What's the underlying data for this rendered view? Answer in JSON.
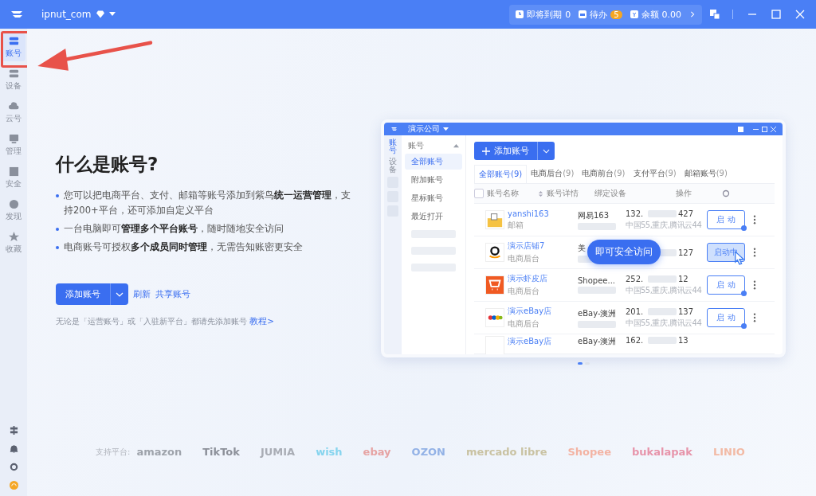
{
  "titlebar": {
    "account": "ipnut_com",
    "stats": [
      {
        "kind": "clock",
        "label": "即将到期",
        "value": "0"
      },
      {
        "kind": "todo",
        "label": "待办",
        "value": "5"
      },
      {
        "kind": "wallet",
        "label": "余额",
        "value": "0.00"
      }
    ]
  },
  "sidebar": {
    "items": [
      {
        "kind": "account",
        "label": "账号",
        "selected": true
      },
      {
        "kind": "device",
        "label": "设备",
        "selected": false
      },
      {
        "kind": "cloud",
        "label": "云号",
        "selected": false
      },
      {
        "kind": "monitor",
        "label": "管理",
        "selected": false
      },
      {
        "kind": "shield",
        "label": "安全",
        "selected": false
      },
      {
        "kind": "compass",
        "label": "发现",
        "selected": false
      },
      {
        "kind": "star",
        "label": "收藏",
        "selected": false
      }
    ]
  },
  "intro": {
    "title": "什么是账号?",
    "bullets": [
      "您可以把电商平台、支付、邮箱等账号添加到紫鸟**统一运营管理**，支持200+平台，还可添加自定义平台",
      "一台电脑即可**管理多个平台账号**，随时随地安全访问",
      "电商账号可授权**多个成员同时管理**，无需告知账密更安全"
    ],
    "add_button": "添加账号",
    "links": [
      "刷新",
      "共享账号"
    ],
    "note": "无论是「运营账号」或「入驻新平台」都请先添加账号",
    "note_link": "教程>"
  },
  "preview": {
    "company": "演示公司",
    "side_items": [
      {
        "label": "账号",
        "selected": true
      },
      {
        "label": "设备",
        "selected": false
      }
    ],
    "nav_group": "账号",
    "nav_items": [
      {
        "label": "全部账号",
        "selected": true
      },
      {
        "label": "附加账号",
        "selected": false
      },
      {
        "label": "星标账号",
        "selected": false
      },
      {
        "label": "最近打开",
        "selected": false
      }
    ],
    "add_button": "添加账号",
    "tabs": [
      {
        "label": "全部账号",
        "count": "(9)",
        "selected": true
      },
      {
        "label": "电商后台",
        "count": "(9)",
        "selected": false
      },
      {
        "label": "电商前台",
        "count": "(9)",
        "selected": false
      },
      {
        "label": "支付平台",
        "count": "(9)",
        "selected": false
      },
      {
        "label": "邮箱账号",
        "count": "(9)",
        "selected": false
      }
    ],
    "columns": [
      "账号名称",
      "账号详情",
      "绑定设备",
      "操作"
    ],
    "rows": [
      {
        "kind": "mail",
        "name": "yanshi163",
        "type": "邮箱",
        "detail": "网易163",
        "ip_start": "132.",
        "ip_end": "427",
        "location": "中国55,重庆,腾讯云44",
        "action": "启 动",
        "active": false
      },
      {
        "kind": "amazon",
        "name": "演示店铺7",
        "type": "电商后台",
        "detail": "美",
        "ip_end": "127",
        "action": "启动中",
        "active": true
      },
      {
        "kind": "cart",
        "name": "演示虾皮店",
        "type": "电商后台",
        "detail": "Shopee...",
        "ip_start": "252.",
        "ip_end": "12",
        "location": "中国55,重庆,腾讯云44",
        "action": "启 动",
        "active": false
      },
      {
        "kind": "ebay",
        "name": "演示eBay店",
        "type": "电商后台",
        "detail": "eBay-澳洲",
        "ip_start": "201.",
        "ip_end": "137",
        "location": "中国55,重庆,腾讯云44",
        "action": "启 动",
        "active": false
      },
      {
        "kind": "blank",
        "name": "演示eBay店",
        "detail": "eBay-澳洲",
        "ip_start": "162.",
        "ip_end": "13"
      }
    ],
    "select_all": {
      "checked": false
    },
    "tooltip": "即可安全访问",
    "dots": [
      {
        "selected": true
      },
      {
        "selected": false
      }
    ]
  },
  "platforms": {
    "label": "支持平台:",
    "items": [
      {
        "name": "amazon",
        "color": "#9ea3ab"
      },
      {
        "name": "TikTok",
        "color": "#8c9099"
      },
      {
        "name": "JUMIA",
        "color": "#a9adb5"
      },
      {
        "name": "wish",
        "color": "#86d4ee"
      },
      {
        "name": "ebay",
        "color": "#e6a3a3"
      },
      {
        "name": "OZON",
        "color": "#93b2e6"
      },
      {
        "name": "mercado libre",
        "color": "#c9c2a2"
      },
      {
        "name": "Shopee",
        "color": "#f3b3a3"
      },
      {
        "name": "bukalapak",
        "color": "#e794aa"
      },
      {
        "name": "LINIO",
        "color": "#f2baa5"
      }
    ]
  }
}
